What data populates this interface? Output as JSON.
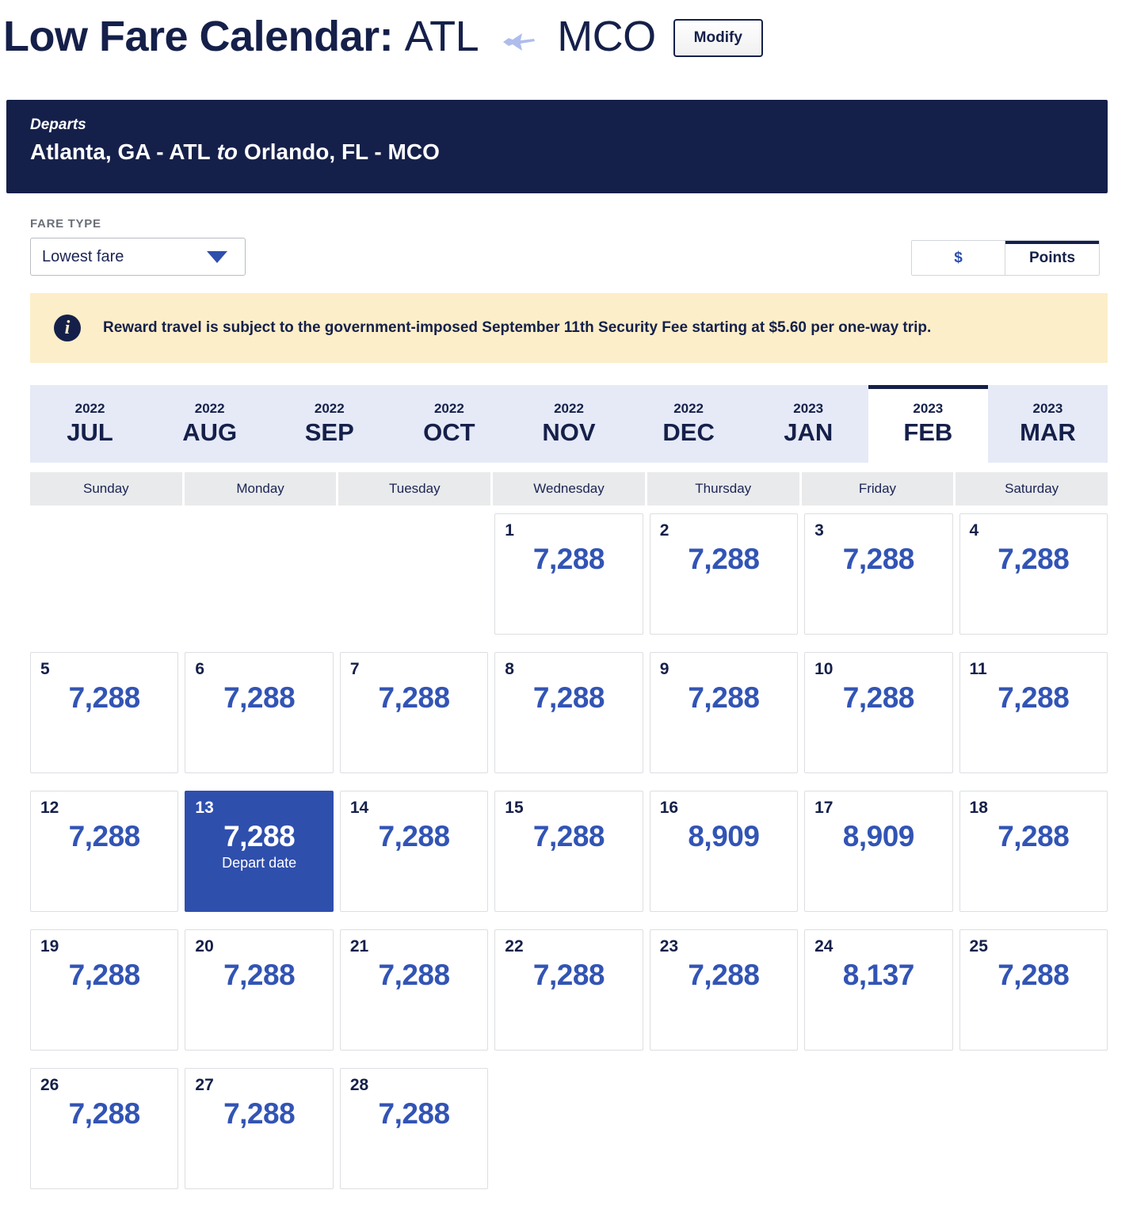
{
  "header": {
    "title_prefix": "Low Fare Calendar:",
    "origin_code": "ATL",
    "plane_icon": "airplane-icon",
    "dest_code": "MCO",
    "modify_label": "Modify"
  },
  "depart_banner": {
    "label": "Departs",
    "origin": "Atlanta, GA - ATL",
    "connector": "to",
    "destination": "Orlando, FL - MCO"
  },
  "controls": {
    "fare_type_label": "FARE TYPE",
    "fare_type_value": "Lowest fare",
    "fare_type_options": [
      "Lowest fare"
    ],
    "caret_icon": "chevron-down-icon",
    "currency": {
      "dollar_label": "$",
      "points_label": "Points",
      "active": "Points"
    }
  },
  "info": {
    "icon": "info-icon",
    "message": "Reward travel is subject to the government-imposed September 11th Security Fee starting at $5.60 per one-way trip."
  },
  "months": [
    {
      "year": "2022",
      "name": "JUL",
      "active": false
    },
    {
      "year": "2022",
      "name": "AUG",
      "active": false
    },
    {
      "year": "2022",
      "name": "SEP",
      "active": false
    },
    {
      "year": "2022",
      "name": "OCT",
      "active": false
    },
    {
      "year": "2022",
      "name": "NOV",
      "active": false
    },
    {
      "year": "2022",
      "name": "DEC",
      "active": false
    },
    {
      "year": "2023",
      "name": "JAN",
      "active": false
    },
    {
      "year": "2023",
      "name": "FEB",
      "active": true
    },
    {
      "year": "2023",
      "name": "MAR",
      "active": false
    }
  ],
  "weekdays": [
    "Sunday",
    "Monday",
    "Tuesday",
    "Wednesday",
    "Thursday",
    "Friday",
    "Saturday"
  ],
  "calendar": {
    "selected_tag": "Depart date",
    "weeks": [
      [
        {
          "day": "",
          "fare": "",
          "empty": true
        },
        {
          "day": "",
          "fare": "",
          "empty": true
        },
        {
          "day": "",
          "fare": "",
          "empty": true
        },
        {
          "day": "1",
          "fare": "7,288"
        },
        {
          "day": "2",
          "fare": "7,288"
        },
        {
          "day": "3",
          "fare": "7,288"
        },
        {
          "day": "4",
          "fare": "7,288"
        }
      ],
      [
        {
          "day": "5",
          "fare": "7,288"
        },
        {
          "day": "6",
          "fare": "7,288"
        },
        {
          "day": "7",
          "fare": "7,288"
        },
        {
          "day": "8",
          "fare": "7,288"
        },
        {
          "day": "9",
          "fare": "7,288"
        },
        {
          "day": "10",
          "fare": "7,288"
        },
        {
          "day": "11",
          "fare": "7,288"
        }
      ],
      [
        {
          "day": "12",
          "fare": "7,288"
        },
        {
          "day": "13",
          "fare": "7,288",
          "selected": true,
          "tag": "Depart date"
        },
        {
          "day": "14",
          "fare": "7,288"
        },
        {
          "day": "15",
          "fare": "7,288"
        },
        {
          "day": "16",
          "fare": "8,909"
        },
        {
          "day": "17",
          "fare": "8,909"
        },
        {
          "day": "18",
          "fare": "7,288"
        }
      ],
      [
        {
          "day": "19",
          "fare": "7,288"
        },
        {
          "day": "20",
          "fare": "7,288"
        },
        {
          "day": "21",
          "fare": "7,288"
        },
        {
          "day": "22",
          "fare": "7,288"
        },
        {
          "day": "23",
          "fare": "7,288"
        },
        {
          "day": "24",
          "fare": "8,137"
        },
        {
          "day": "25",
          "fare": "7,288"
        }
      ],
      [
        {
          "day": "26",
          "fare": "7,288"
        },
        {
          "day": "27",
          "fare": "7,288"
        },
        {
          "day": "28",
          "fare": "7,288"
        },
        {
          "day": "",
          "fare": "",
          "empty": true
        },
        {
          "day": "",
          "fare": "",
          "empty": true
        },
        {
          "day": "",
          "fare": "",
          "empty": true
        },
        {
          "day": "",
          "fare": "",
          "empty": true
        }
      ]
    ]
  },
  "colors": {
    "navy": "#15204a",
    "accent_blue": "#3254b4",
    "selected_blue": "#2f4fad",
    "info_bg": "#fceec8",
    "tab_bg": "#e6eaf7",
    "weekday_bg": "#e9eaec",
    "plane": "#aebdec"
  }
}
